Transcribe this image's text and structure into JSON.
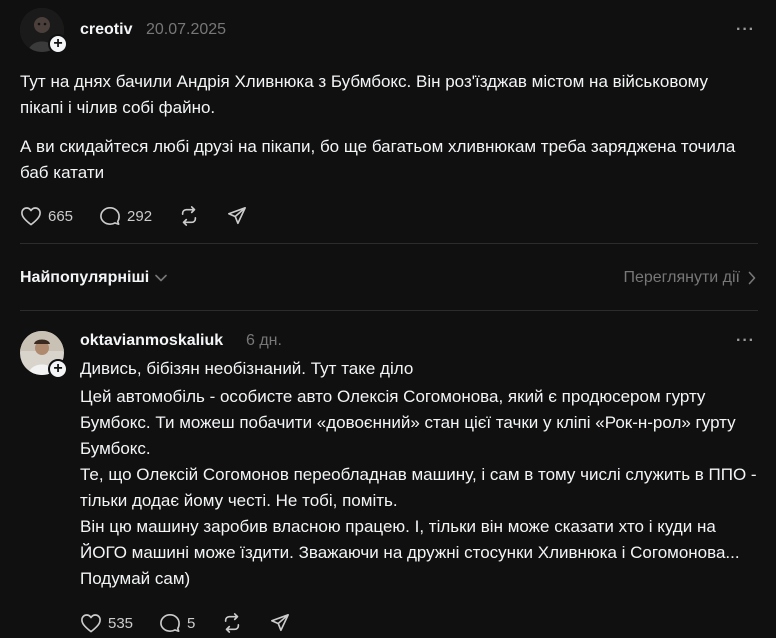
{
  "post": {
    "username": "creotiv",
    "date": "20.07.2025",
    "more_label": "···",
    "paragraphs": [
      "Тут на днях бачили Андрія Хливнюка з Бубмбокс. Він роз'їзджав містом на військовому пікапі і чілив собі файно.",
      "А ви скидайтеся любі друзі на пікапи, бо ще багатьом хливнюкам треба заряджена точила баб катати"
    ],
    "likes": "665",
    "comments": "292"
  },
  "replies_header": {
    "sort_label": "Найпопулярніші",
    "view_activity": "Переглянути дії"
  },
  "reply": {
    "username": "oktavianmoskaliuk",
    "age": "6 дн.",
    "more_label": "···",
    "lines": [
      "Дивись, бібізян необізнаний. Тут таке діло",
      "Цей автомобіль - особисте авто Олексія Согомонова, який є продюсером гурту Бумбокс. Ти можеш побачити «довоєнний» стан цієї тачки у кліпі «Рок-н-рол» гурту Бумбокс.",
      "Те, що Олексій Согомонов переобладнав машину, і сам в тому числі служить в ППО - тільки додає йому честі. Не тобі, поміть.",
      "Він цю машину заробив власною працею. І, тільки він може сказати хто і куди на ЙОГО машині може їздити. Зважаючи на дружні стосунки Хливнюка і Согомонова... Подумай сам)"
    ],
    "likes": "535",
    "comments": "5"
  }
}
